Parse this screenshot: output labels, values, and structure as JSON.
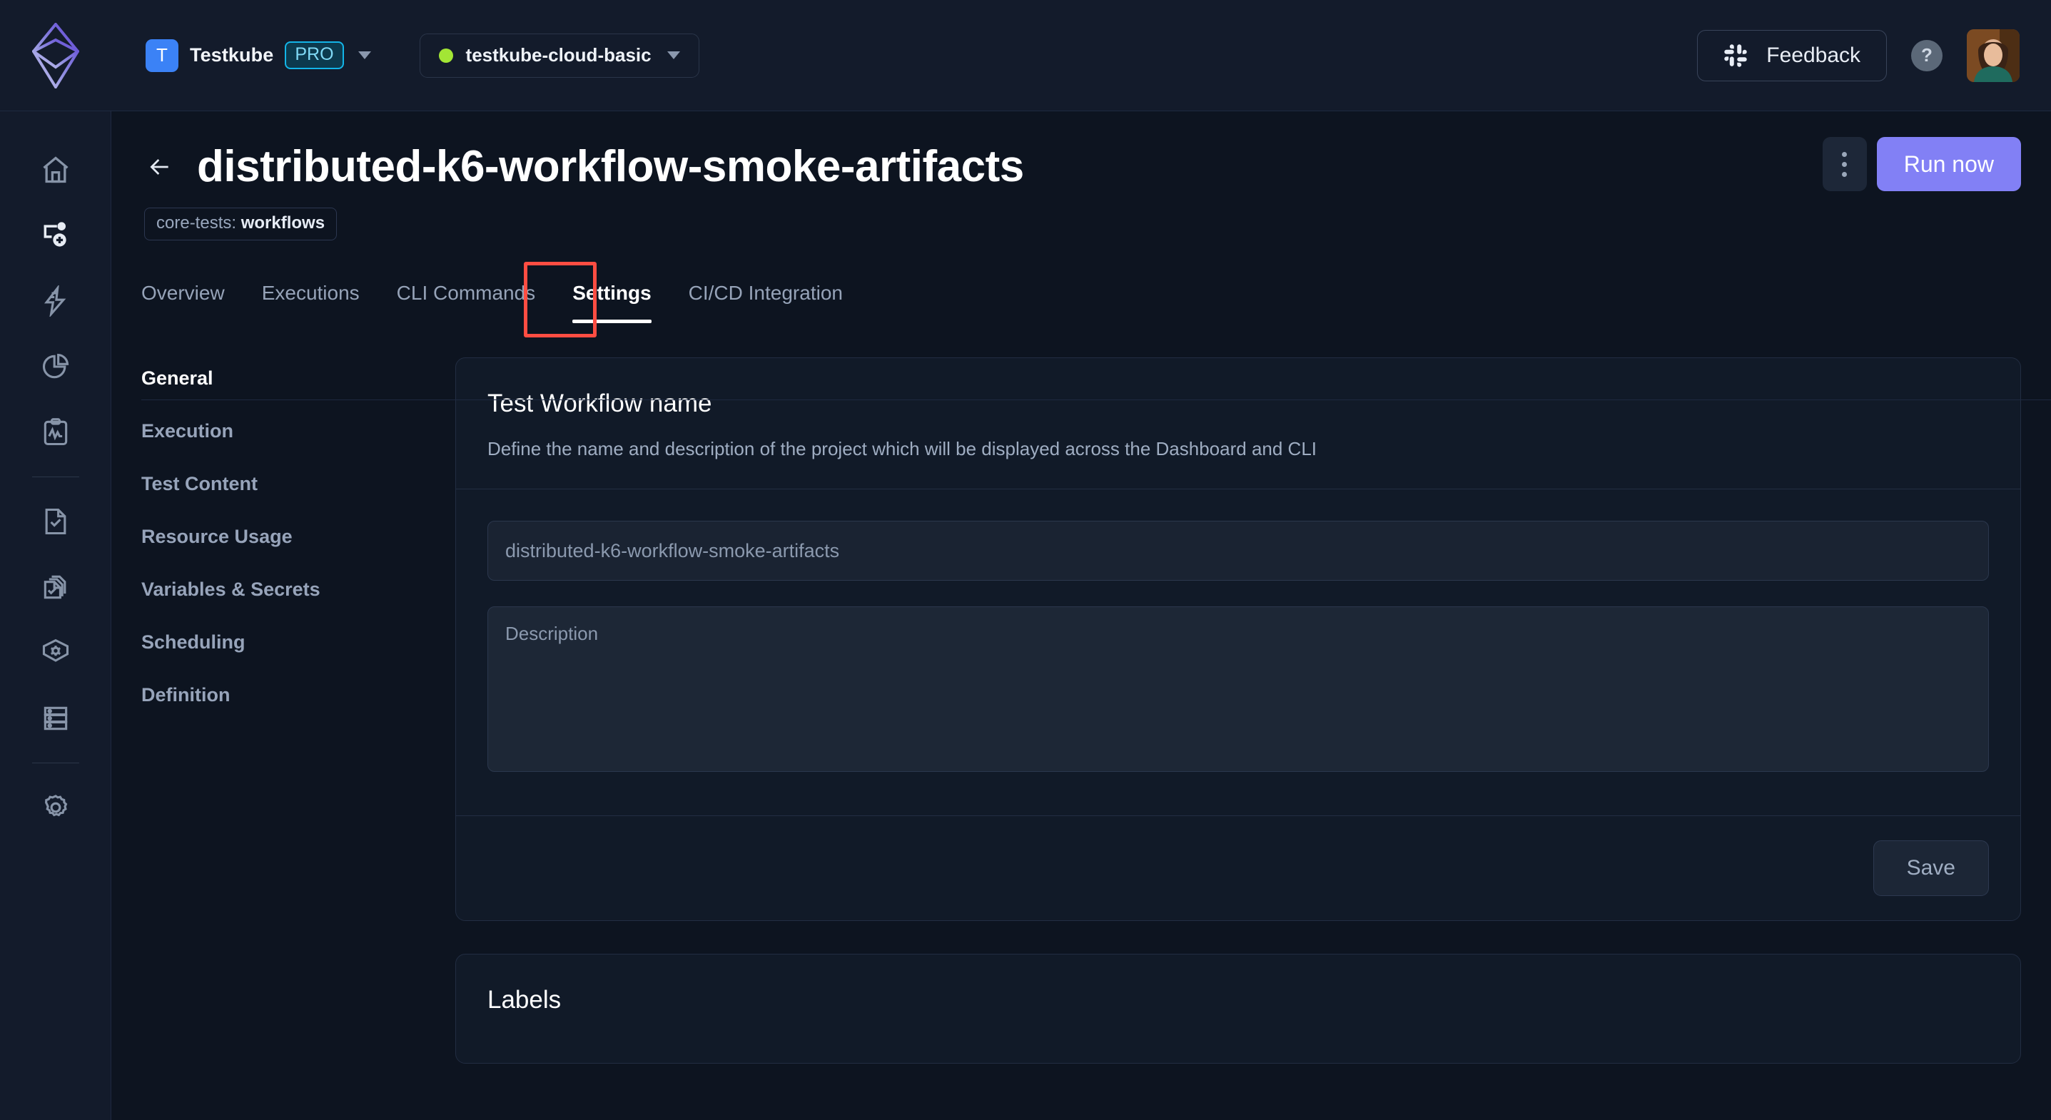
{
  "topbar": {
    "logo_icon": "testkube-diamond-logo",
    "org": {
      "avatar_initial": "T",
      "name": "Testkube",
      "plan_badge": "PRO"
    },
    "environment": {
      "status_color": "#a3e635",
      "name": "testkube-cloud-basic"
    },
    "feedback_label": "Feedback",
    "feedback_icon": "slack-icon",
    "help_label": "?",
    "avatar_name": "user-avatar"
  },
  "rail": {
    "items": [
      {
        "name": "home",
        "icon": "home-icon"
      },
      {
        "name": "create-workflow",
        "icon": "add-workflow-icon"
      },
      {
        "name": "triggers",
        "icon": "lightning-icon"
      },
      {
        "name": "insights",
        "icon": "pie-chart-icon"
      },
      {
        "name": "reports",
        "icon": "clipboard-chart-icon"
      },
      {
        "name": "tests",
        "icon": "file-check-icon"
      },
      {
        "name": "test-suites",
        "icon": "files-check-icon"
      },
      {
        "name": "security",
        "icon": "shield-gear-icon"
      },
      {
        "name": "resources",
        "icon": "server-icon"
      },
      {
        "name": "settings",
        "icon": "gear-icon"
      }
    ]
  },
  "header": {
    "back_icon": "back-arrow-icon",
    "title": "distributed-k6-workflow-smoke-artifacts",
    "label_chip_key": "core-tests: ",
    "label_chip_value": "workflows",
    "kebab_icon": "more-vertical-icon",
    "run_label": "Run now",
    "run_button_color": "#8280f5"
  },
  "tabs": {
    "items": [
      {
        "label": "Overview",
        "active": false
      },
      {
        "label": "Executions",
        "active": false
      },
      {
        "label": "CLI Commands",
        "active": false
      },
      {
        "label": "Settings",
        "active": true
      },
      {
        "label": "CI/CD Integration",
        "active": false
      }
    ],
    "highlight_color": "#ff4d42",
    "highlighted_tab": "Settings"
  },
  "subnav": {
    "items": [
      {
        "label": "General",
        "active": true
      },
      {
        "label": "Execution",
        "active": false
      },
      {
        "label": "Test Content",
        "active": false
      },
      {
        "label": "Resource Usage",
        "active": false
      },
      {
        "label": "Variables & Secrets",
        "active": false
      },
      {
        "label": "Scheduling",
        "active": false
      },
      {
        "label": "Definition",
        "active": false
      }
    ]
  },
  "cards": {
    "general": {
      "title": "Test Workflow name",
      "description": "Define the name and description of the project which will be displayed across the Dashboard and CLI",
      "name_value": "",
      "name_placeholder": "distributed-k6-workflow-smoke-artifacts",
      "desc_value": "",
      "desc_placeholder": "Description",
      "save_label": "Save"
    },
    "labels": {
      "title": "Labels"
    }
  }
}
